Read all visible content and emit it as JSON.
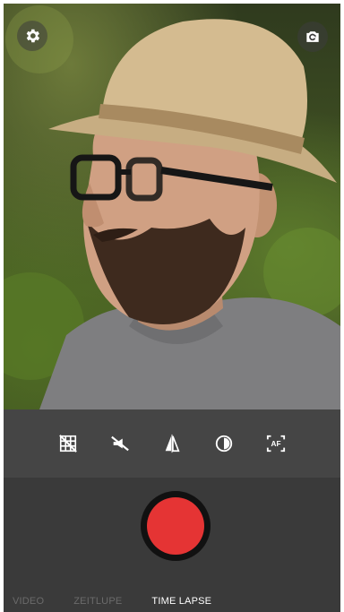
{
  "viewfinder": {
    "description_icon": "person-photo"
  },
  "top_buttons": {
    "settings_icon": "gear-icon",
    "switch_camera_icon": "camera-switch-icon"
  },
  "toolbar": {
    "icons": [
      "grid-off-icon",
      "flash-off-icon",
      "mirror-icon",
      "exposure-icon",
      "autofocus-icon"
    ],
    "af_label": "AF"
  },
  "record": {
    "color": "#e53434"
  },
  "modes": {
    "items": [
      "VIDEO",
      "ZEITLUPE",
      "TIME LAPSE"
    ],
    "active": "TIME LAPSE"
  }
}
